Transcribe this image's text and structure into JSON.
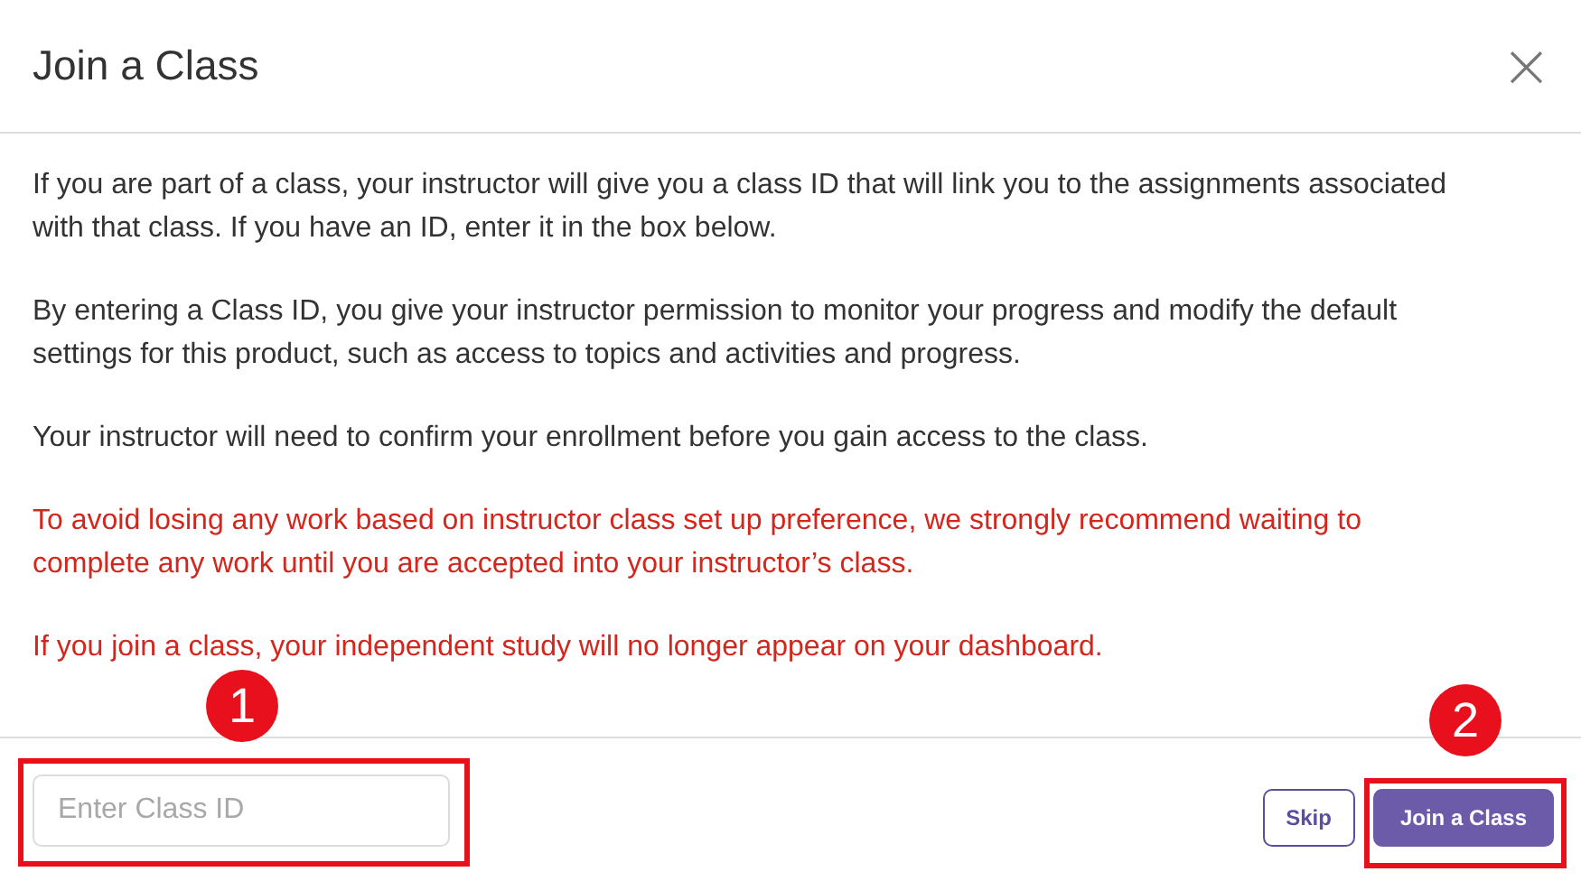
{
  "dialog": {
    "title": "Join a Class",
    "close": "×"
  },
  "paragraphs": [
    {
      "text": "If you are part of a class, your instructor will give you a class ID that will link you to the assignments associated with that class. If you have an ID, enter it in the box below.",
      "kind": "info"
    },
    {
      "text": "By entering a Class ID, you give your instructor permission to monitor your progress and modify the default settings for this product, such as access to topics and activities and progress.",
      "kind": "info"
    },
    {
      "text": "Your instructor will need to confirm your enrollment before you gain access to the class.",
      "kind": "info"
    },
    {
      "text": "To avoid losing any work based on instructor class set up preference, we strongly recommend waiting to complete any work until you are accepted into your instructor’s class.",
      "kind": "warning"
    },
    {
      "text": "If you join a class, your independent study will no longer appear on your dashboard.",
      "kind": "warning"
    }
  ],
  "class_id_field": {
    "placeholder": "Enter Class ID"
  },
  "buttons": [
    {
      "label": "Skip",
      "kind": "secondary"
    },
    {
      "label": "Join a Class",
      "kind": "primary"
    }
  ],
  "callouts": [
    {
      "number": "1",
      "kind": "field"
    },
    {
      "number": "2",
      "kind": "button"
    }
  ]
}
